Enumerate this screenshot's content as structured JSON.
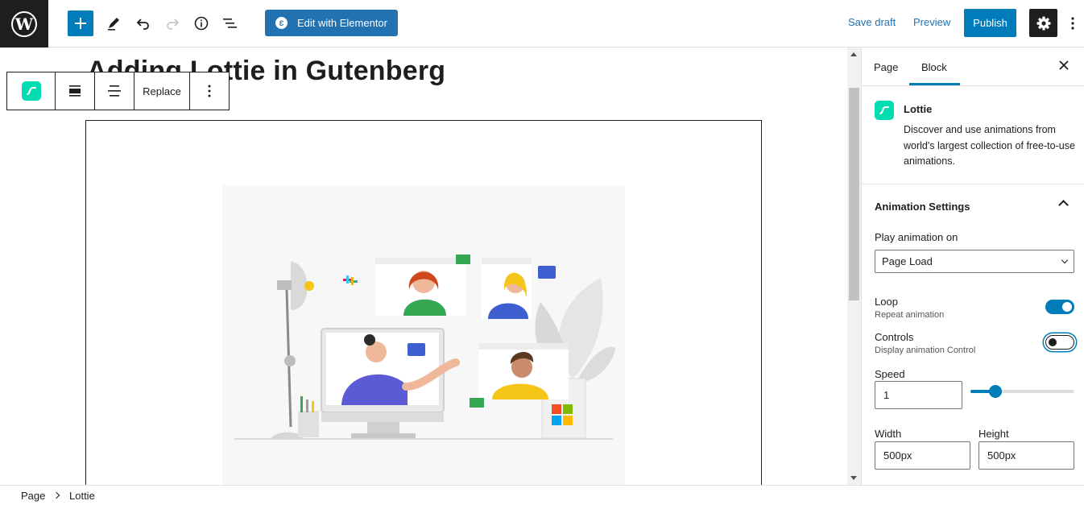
{
  "topbar": {
    "elementor_label": "Edit with Elementor",
    "save_draft_label": "Save draft",
    "preview_label": "Preview",
    "publish_label": "Publish"
  },
  "editor": {
    "post_title": "Adding Lottie in Gutenberg",
    "block_toolbar": {
      "replace_label": "Replace"
    }
  },
  "sidebar": {
    "tabs": [
      {
        "label": "Page"
      },
      {
        "label": "Block",
        "active": true
      }
    ],
    "block": {
      "name": "Lottie",
      "description": "Discover and use animations from world's largest collection of free-to-use animations."
    },
    "panel": {
      "title": "Animation Settings",
      "play_on_label": "Play animation on",
      "play_on_value": "Page Load",
      "loop_label": "Loop",
      "loop_help": "Repeat animation",
      "loop_on": true,
      "controls_label": "Controls",
      "controls_help": "Display animation Control",
      "controls_on": false,
      "speed_label": "Speed",
      "speed_value": "1",
      "speed_slider_fraction": 0.2,
      "width_label": "Width",
      "width_value": "500px",
      "height_label": "Height",
      "height_value": "500px"
    }
  },
  "breadcrumb": [
    {
      "label": "Page"
    },
    {
      "label": "Lottie"
    }
  ],
  "colors": {
    "accent": "#007cba",
    "elementor": "#2271b1",
    "lottie": "#00ddb3"
  }
}
